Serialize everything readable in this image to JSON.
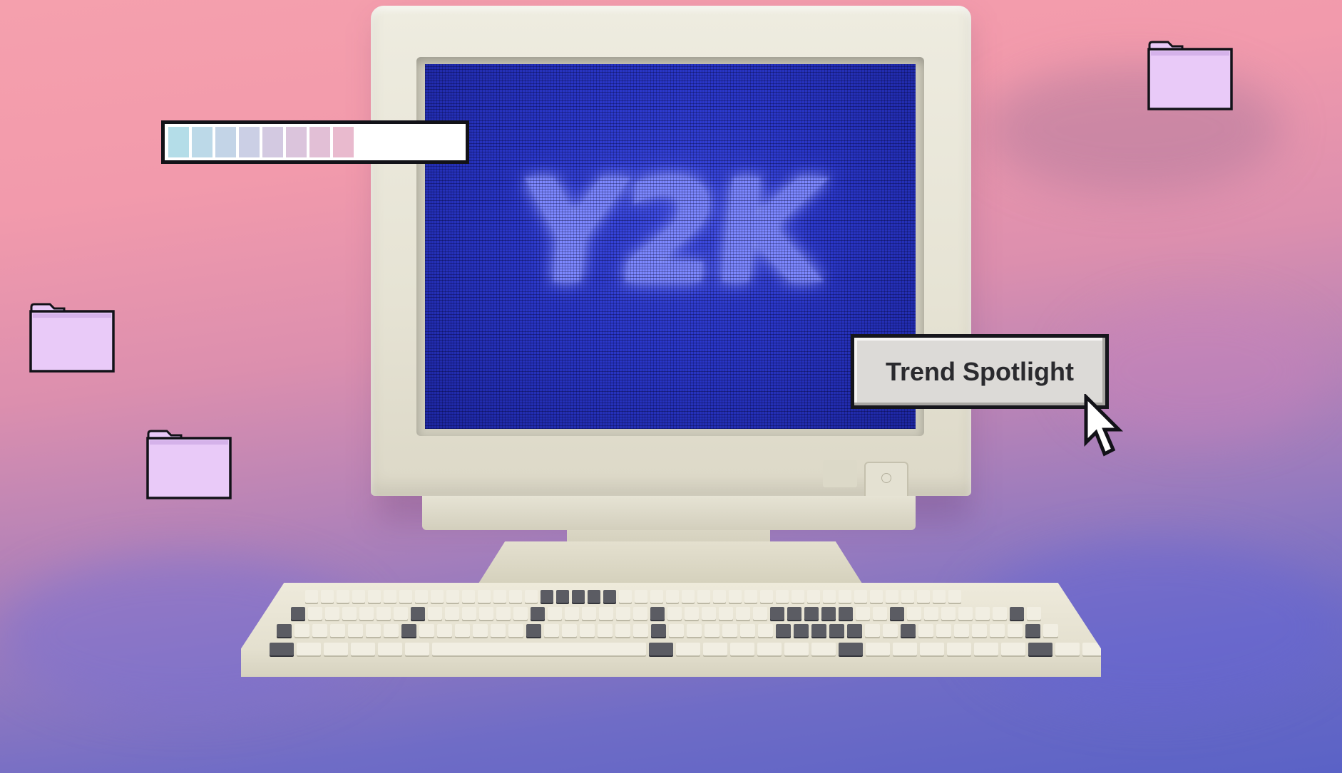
{
  "scene": {
    "screen_text": "Y2K",
    "callout_button_label": "Trend Spotlight"
  },
  "progress_bar": {
    "fraction": 0.6,
    "segment_colors": [
      "#b4dde8",
      "#bcd9e8",
      "#c3d4e7",
      "#cbcfe5",
      "#d3c9e1",
      "#dbc4dc",
      "#e2bfd6",
      "#e9bace"
    ]
  },
  "folders": [
    {
      "icon": "folder-icon"
    },
    {
      "icon": "folder-icon"
    },
    {
      "icon": "folder-icon"
    }
  ],
  "colors": {
    "folder_fill": "#e9caf8",
    "screen_blue": "#2a37c8",
    "outline": "#121218"
  }
}
